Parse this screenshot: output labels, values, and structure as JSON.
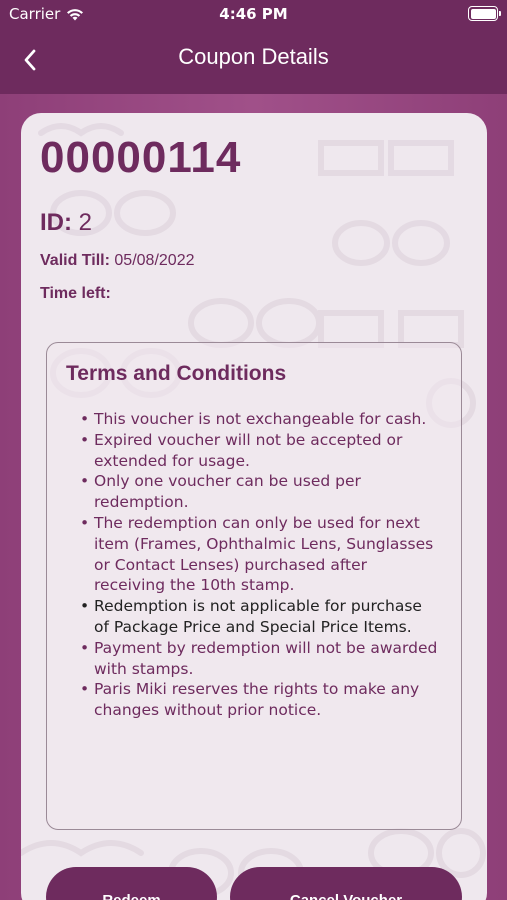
{
  "status_bar": {
    "carrier": "Carrier",
    "time": "4:46 PM"
  },
  "header": {
    "title": "Coupon Details",
    "back_icon": "chevron-left-icon"
  },
  "coupon": {
    "code": "00000114",
    "id_label": "ID:",
    "id_value": "2",
    "valid_label": "Valid Till:",
    "valid_value": "05/08/2022",
    "time_left_label": "Time left:"
  },
  "terms": {
    "title": "Terms and Conditions",
    "items": [
      "This voucher is not exchangeable for cash.",
      "Expired voucher will not be accepted or extended for usage.",
      "Only one voucher can be used per redemption.",
      "The redemption can only be used for next item (Frames, Ophthalmic Lens, Sunglasses or Contact Lenses) purchased after receiving the 10th stamp.",
      "Redemption is not applicable for purchase of Package Price and Special Price Items.",
      "Payment by redemption will not be awarded with stamps.",
      "Paris Miki reserves the rights to make any changes without prior notice."
    ]
  },
  "buttons": {
    "redeem": "Redeem",
    "cancel": "Cancel Voucher"
  },
  "colors": {
    "primary": "#6e2b5e",
    "card": "#efe8ee",
    "accent_bg": "#a05089"
  }
}
